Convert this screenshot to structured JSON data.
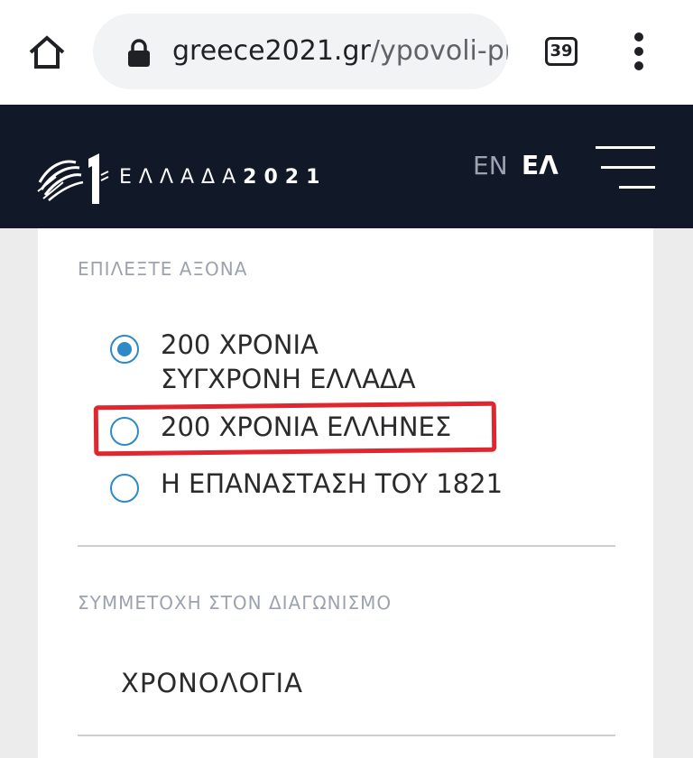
{
  "browser": {
    "url_domain": "greece2021.gr",
    "url_path": "/ypovoli-pro",
    "tab_count": "39",
    "icons": [
      "home-icon",
      "lock-icon",
      "tabs-icon",
      "more-vert-icon"
    ]
  },
  "header": {
    "logo_prefix": "ΕΛΛΑΔΑ",
    "logo_year": "2021",
    "lang_en": "EN",
    "lang_el": "ΕΛ",
    "bg_color": "#111827"
  },
  "form": {
    "axis_label": "ΕΠΙΛΕΞΤΕ ΑΞΟΝΑ",
    "axis_options": [
      {
        "line1": "200 ΧΡΟΝΙΑ",
        "line2": "ΣΥΓΧΡΟΝΗ ΕΛΛΑΔΑ",
        "selected": true
      },
      {
        "line1": "200 ΧΡΟΝΙΑ ΕΛΛΗΝΕΣ",
        "selected": false,
        "highlighted": true
      },
      {
        "line1": "Η ΕΠΑΝΑΣΤΑΣΗ ΤΟΥ 1821",
        "selected": false
      }
    ],
    "participation_label": "ΣΥΜΜΕΤΟΧΗ ΣΤΟΝ ΔΙΑΓΩΝΙΣΜΟ",
    "participation_value": "ΧΡΟΝΟΛΟΓΙΑ",
    "accent_color": "#2d8ac7",
    "highlight_color": "#e0262e"
  }
}
